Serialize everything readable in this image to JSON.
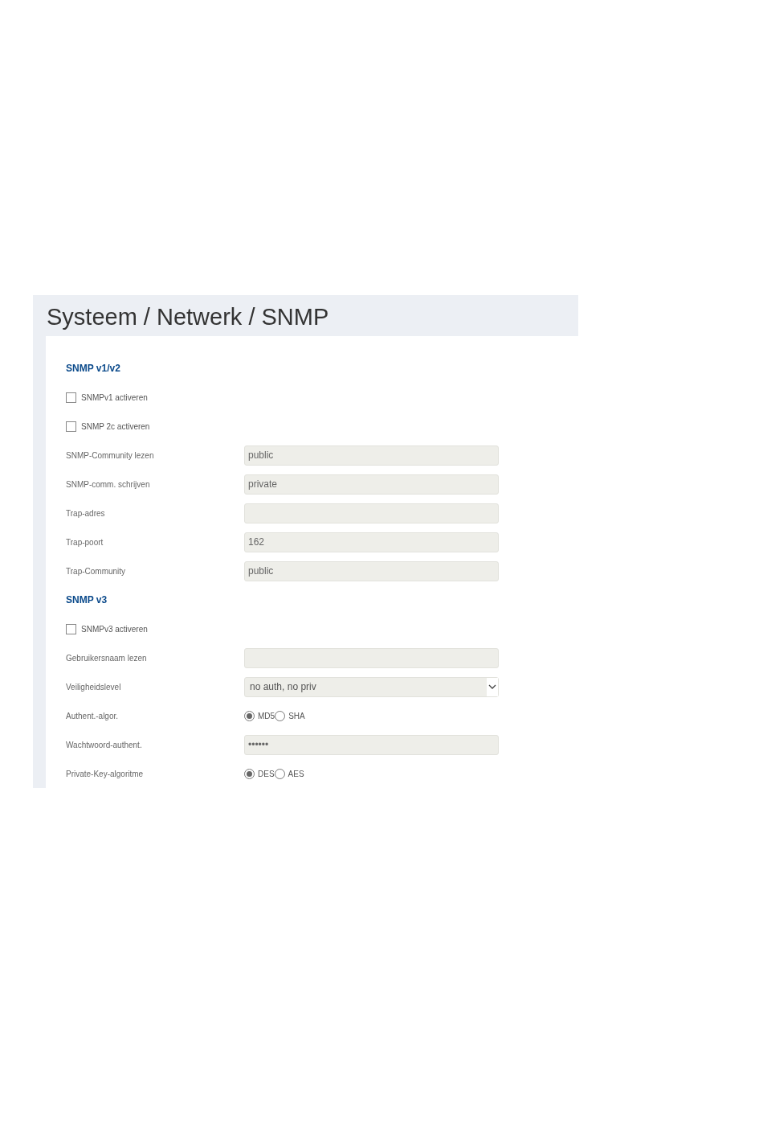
{
  "page": {
    "title": "Systeem / Netwerk / SNMP"
  },
  "sections": [
    {
      "title": "SNMP v1/v2",
      "fields": [
        {
          "kind": "checkbox",
          "label": "SNMPv1 activeren",
          "checked": false
        },
        {
          "kind": "checkbox",
          "label": "SNMP 2c activeren",
          "checked": false
        },
        {
          "kind": "text",
          "label": "SNMP-Community lezen",
          "value": "public"
        },
        {
          "kind": "text",
          "label": "SNMP-comm. schrijven",
          "value": "private"
        },
        {
          "kind": "text",
          "label": "Trap-adres"
        },
        {
          "kind": "text",
          "label": "Trap-poort",
          "value": "162"
        },
        {
          "kind": "text",
          "label": "Trap-Community",
          "value": "public"
        }
      ]
    },
    {
      "title": "SNMP v3",
      "fields": [
        {
          "kind": "checkbox",
          "label": "SNMPv3 activeren",
          "checked": false
        },
        {
          "kind": "text",
          "label": "Gebruikersnaam lezen"
        },
        {
          "kind": "select",
          "label": "Veiligheidslevel",
          "value": "no auth, no priv"
        },
        {
          "kind": "radio",
          "label": "Authent.-algor.",
          "options": [
            {
              "label": "MD5",
              "selected": true
            },
            {
              "label": "SHA",
              "selected": false
            }
          ]
        },
        {
          "kind": "password",
          "label": "Wachtwoord-authent.",
          "value": "••••••"
        },
        {
          "kind": "radio",
          "label": "Private-Key-algoritme",
          "options": [
            {
              "label": "DES",
              "selected": true
            },
            {
              "label": "AES",
              "selected": false
            }
          ]
        }
      ]
    }
  ]
}
